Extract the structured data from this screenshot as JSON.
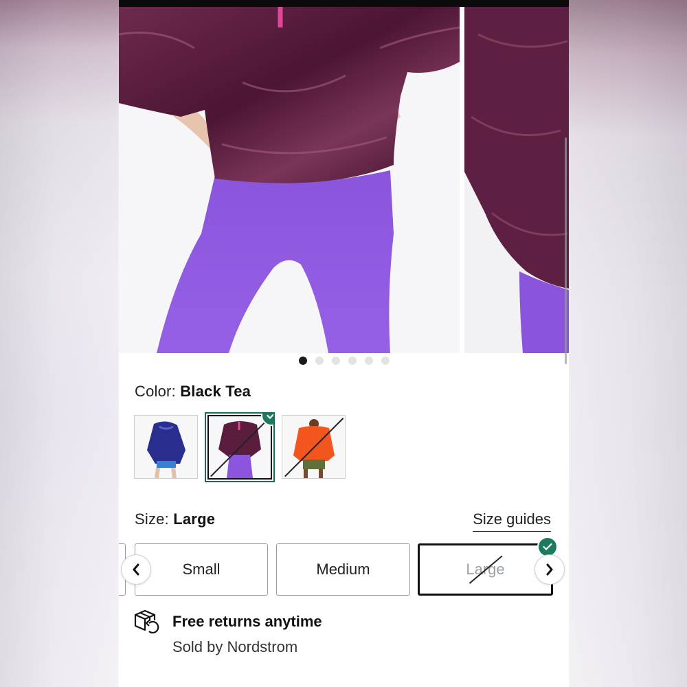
{
  "gallery": {
    "slide_count": 6,
    "active_index": 0
  },
  "color": {
    "label": "Color:",
    "selected_name": "Black Tea",
    "swatches": [
      {
        "name": "blue-swatch",
        "available": true,
        "selected": false
      },
      {
        "name": "black-tea-swatch",
        "available": false,
        "selected": true
      },
      {
        "name": "orange-swatch",
        "available": false,
        "selected": false
      }
    ]
  },
  "size": {
    "label": "Size:",
    "selected_name": "Large",
    "guides_label": "Size guides",
    "options": [
      {
        "label": "Small",
        "available": true,
        "selected": false
      },
      {
        "label": "Medium",
        "available": true,
        "selected": false
      },
      {
        "label": "Large",
        "available": false,
        "selected": true
      }
    ]
  },
  "returns": {
    "title": "Free returns anytime",
    "subtitle": "Sold by Nordstrom",
    "icon": "box-return-icon"
  },
  "colors": {
    "accent_green": "#1c7a5e",
    "jacket": "#5a1d3d",
    "leggings": "#8b55de",
    "orange_jacket": "#f2561e",
    "blue_jacket": "#2a2f8f"
  }
}
